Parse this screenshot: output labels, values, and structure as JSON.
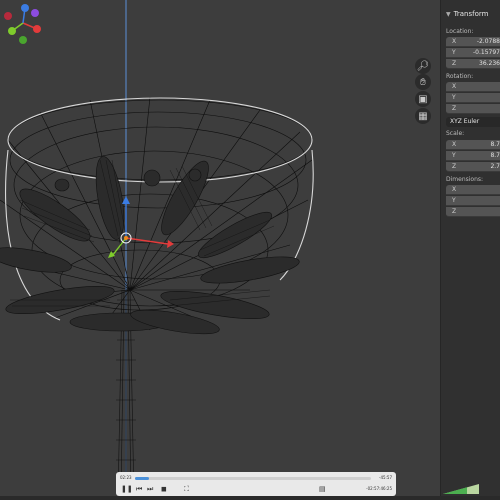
{
  "transform_panel": {
    "title": "Transform",
    "location_label": "Location:",
    "location": [
      {
        "axis": "X",
        "value": "-2.0788"
      },
      {
        "axis": "Y",
        "value": "-0.15797"
      },
      {
        "axis": "Z",
        "value": "36.236"
      }
    ],
    "rotation_label": "Rotation:",
    "rotation": [
      {
        "axis": "X",
        "value": ""
      },
      {
        "axis": "Y",
        "value": ""
      },
      {
        "axis": "Z",
        "value": ""
      }
    ],
    "rotation_mode": "XYZ Euler",
    "scale_label": "Scale:",
    "scale": [
      {
        "axis": "X",
        "value": "8.7"
      },
      {
        "axis": "Y",
        "value": "8.7"
      },
      {
        "axis": "Z",
        "value": "2.7"
      }
    ],
    "dimensions_label": "Dimensions:",
    "dimensions": [
      {
        "axis": "X",
        "value": ""
      },
      {
        "axis": "Y",
        "value": ""
      },
      {
        "axis": "Z",
        "value": ""
      }
    ]
  },
  "viewport_tools": {
    "zoom_icon": "magnifier-icon",
    "pan_icon": "hand-icon",
    "camera_icon": "camera-icon",
    "grid_icon": "grid-icon"
  },
  "video_player": {
    "elapsed": "02:23",
    "end": "-45:57",
    "remaining": "-02:57:46:25",
    "progress": 0.06,
    "accent": "#4a90d9"
  },
  "colors": {
    "viewport_bg": "#3d3d3d",
    "panel_bg": "#303030",
    "axis_x": "#e33b3b",
    "axis_y": "#7fcc2c",
    "axis_z": "#3b7ce3"
  }
}
